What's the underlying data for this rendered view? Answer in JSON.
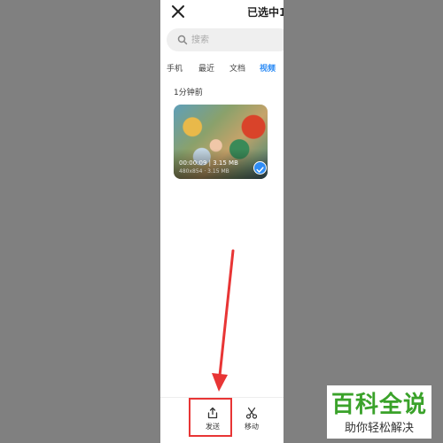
{
  "header": {
    "title": "已选中1"
  },
  "search": {
    "placeholder": "搜索"
  },
  "tabs": [
    {
      "label": "手机",
      "active": false
    },
    {
      "label": "最近",
      "active": false
    },
    {
      "label": "文档",
      "active": false
    },
    {
      "label": "视频",
      "active": true
    }
  ],
  "section": {
    "label": "1分钟前"
  },
  "video": {
    "duration_size": "00:00:09 | 3.15 MB",
    "sub": "480x854 · 3.15 MB",
    "selected": true
  },
  "bottom_bar": {
    "send_label": "发送",
    "move_label": "移动"
  },
  "watermark": {
    "main": "百科全说",
    "sub": "助你轻松解决"
  },
  "colors": {
    "accent": "#2f8df5",
    "highlight": "#e83535",
    "brand": "#3aa22a"
  }
}
